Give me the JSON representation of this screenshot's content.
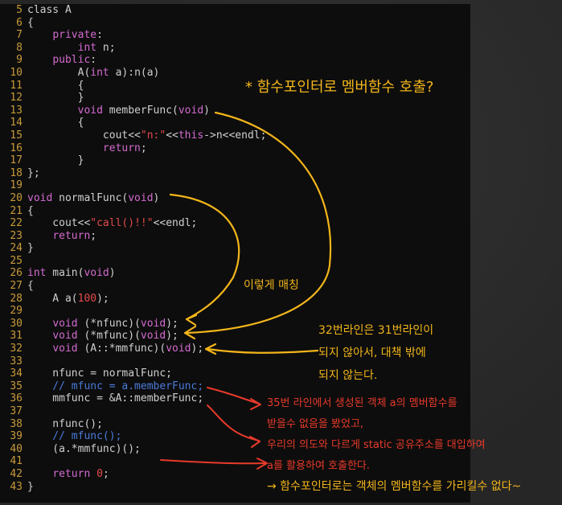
{
  "code_lines": [
    {
      "n": "5",
      "parts": [
        {
          "c": "txt",
          "t": "class A"
        }
      ]
    },
    {
      "n": "6",
      "parts": [
        {
          "c": "txt",
          "t": "{"
        }
      ]
    },
    {
      "n": "7",
      "parts": [
        {
          "c": "txt",
          "t": "    "
        },
        {
          "c": "kw",
          "t": "private"
        },
        {
          "c": "txt",
          "t": ":"
        }
      ]
    },
    {
      "n": "8",
      "parts": [
        {
          "c": "txt",
          "t": "        "
        },
        {
          "c": "kw",
          "t": "int"
        },
        {
          "c": "txt",
          "t": " n;"
        }
      ]
    },
    {
      "n": "9",
      "parts": [
        {
          "c": "txt",
          "t": "    "
        },
        {
          "c": "kw",
          "t": "public"
        },
        {
          "c": "txt",
          "t": ":"
        }
      ]
    },
    {
      "n": "10",
      "parts": [
        {
          "c": "txt",
          "t": "        A("
        },
        {
          "c": "kw",
          "t": "int"
        },
        {
          "c": "txt",
          "t": " a):n(a)"
        }
      ]
    },
    {
      "n": "11",
      "parts": [
        {
          "c": "txt",
          "t": "        {"
        }
      ]
    },
    {
      "n": "12",
      "parts": [
        {
          "c": "txt",
          "t": "        }"
        }
      ]
    },
    {
      "n": "13",
      "parts": [
        {
          "c": "txt",
          "t": "        "
        },
        {
          "c": "kw",
          "t": "void"
        },
        {
          "c": "txt",
          "t": " memberFunc("
        },
        {
          "c": "kw",
          "t": "void"
        },
        {
          "c": "txt",
          "t": ")"
        }
      ]
    },
    {
      "n": "14",
      "parts": [
        {
          "c": "txt",
          "t": "        {"
        }
      ]
    },
    {
      "n": "15",
      "parts": [
        {
          "c": "txt",
          "t": "            cout<<"
        },
        {
          "c": "str",
          "t": "\"n:\""
        },
        {
          "c": "txt",
          "t": "<<"
        },
        {
          "c": "kw",
          "t": "this"
        },
        {
          "c": "txt",
          "t": "->n<<endl;"
        }
      ]
    },
    {
      "n": "16",
      "parts": [
        {
          "c": "txt",
          "t": "            "
        },
        {
          "c": "kw",
          "t": "return"
        },
        {
          "c": "txt",
          "t": ";"
        }
      ]
    },
    {
      "n": "17",
      "parts": [
        {
          "c": "txt",
          "t": "        }"
        }
      ]
    },
    {
      "n": "18",
      "parts": [
        {
          "c": "txt",
          "t": "};"
        }
      ]
    },
    {
      "n": "19",
      "parts": [
        {
          "c": "txt",
          "t": ""
        }
      ]
    },
    {
      "n": "20",
      "parts": [
        {
          "c": "kw",
          "t": "void"
        },
        {
          "c": "txt",
          "t": " normalFunc("
        },
        {
          "c": "kw",
          "t": "void"
        },
        {
          "c": "txt",
          "t": ")"
        }
      ]
    },
    {
      "n": "21",
      "parts": [
        {
          "c": "txt",
          "t": "{"
        }
      ]
    },
    {
      "n": "22",
      "parts": [
        {
          "c": "txt",
          "t": "    cout<<"
        },
        {
          "c": "str",
          "t": "\"call()!!\""
        },
        {
          "c": "txt",
          "t": "<<endl;"
        }
      ]
    },
    {
      "n": "23",
      "parts": [
        {
          "c": "txt",
          "t": "    "
        },
        {
          "c": "kw",
          "t": "return"
        },
        {
          "c": "txt",
          "t": ";"
        }
      ]
    },
    {
      "n": "24",
      "parts": [
        {
          "c": "txt",
          "t": "}"
        }
      ]
    },
    {
      "n": "25",
      "parts": [
        {
          "c": "txt",
          "t": ""
        }
      ]
    },
    {
      "n": "26",
      "parts": [
        {
          "c": "kw",
          "t": "int"
        },
        {
          "c": "txt",
          "t": " main("
        },
        {
          "c": "kw",
          "t": "void"
        },
        {
          "c": "txt",
          "t": ")"
        }
      ]
    },
    {
      "n": "27",
      "parts": [
        {
          "c": "txt",
          "t": "{"
        }
      ]
    },
    {
      "n": "28",
      "parts": [
        {
          "c": "txt",
          "t": "    A a("
        },
        {
          "c": "num",
          "t": "100"
        },
        {
          "c": "txt",
          "t": ");"
        }
      ]
    },
    {
      "n": "29",
      "parts": [
        {
          "c": "txt",
          "t": ""
        }
      ]
    },
    {
      "n": "30",
      "parts": [
        {
          "c": "txt",
          "t": "    "
        },
        {
          "c": "kw",
          "t": "void"
        },
        {
          "c": "txt",
          "t": " (*nfunc)("
        },
        {
          "c": "kw",
          "t": "void"
        },
        {
          "c": "txt",
          "t": ");"
        }
      ]
    },
    {
      "n": "31",
      "parts": [
        {
          "c": "txt",
          "t": "    "
        },
        {
          "c": "kw",
          "t": "void"
        },
        {
          "c": "txt",
          "t": " (*mfunc)("
        },
        {
          "c": "kw",
          "t": "void"
        },
        {
          "c": "txt",
          "t": ");"
        }
      ]
    },
    {
      "n": "32",
      "parts": [
        {
          "c": "txt",
          "t": "    "
        },
        {
          "c": "kw",
          "t": "void"
        },
        {
          "c": "txt",
          "t": " (A::*mmfunc)("
        },
        {
          "c": "kw",
          "t": "void"
        },
        {
          "c": "txt",
          "t": ");"
        }
      ]
    },
    {
      "n": "33",
      "parts": [
        {
          "c": "txt",
          "t": ""
        }
      ]
    },
    {
      "n": "34",
      "parts": [
        {
          "c": "txt",
          "t": "    nfunc = normalFunc;"
        }
      ]
    },
    {
      "n": "35",
      "parts": [
        {
          "c": "cm",
          "t": "    // mfunc = a.memberFunc;"
        }
      ]
    },
    {
      "n": "36",
      "parts": [
        {
          "c": "txt",
          "t": "    mmfunc = &A::memberFunc;"
        }
      ]
    },
    {
      "n": "37",
      "parts": [
        {
          "c": "txt",
          "t": ""
        }
      ]
    },
    {
      "n": "38",
      "parts": [
        {
          "c": "txt",
          "t": "    nfunc();"
        }
      ]
    },
    {
      "n": "39",
      "parts": [
        {
          "c": "cm",
          "t": "    // mfunc();"
        }
      ]
    },
    {
      "n": "40",
      "parts": [
        {
          "c": "txt",
          "t": "    (a.*mmfunc)();"
        }
      ]
    },
    {
      "n": "41",
      "parts": [
        {
          "c": "txt",
          "t": ""
        }
      ]
    },
    {
      "n": "42",
      "parts": [
        {
          "c": "txt",
          "t": "    "
        },
        {
          "c": "kw",
          "t": "return"
        },
        {
          "c": "txt",
          "t": " "
        },
        {
          "c": "num",
          "t": "0"
        },
        {
          "c": "txt",
          "t": ";"
        }
      ]
    },
    {
      "n": "43",
      "parts": [
        {
          "c": "txt",
          "t": "}"
        }
      ]
    }
  ],
  "notes": {
    "title": "* 함수포인터로  멤버함수 호출?",
    "mapping": "이렇게 매칭",
    "line32_1": "32번라인은 31번라인이",
    "line32_2": "되지 않아서, 대책 밖에",
    "line32_3": "되지 않는다.",
    "red1": "35번 라인에서 생성된 객체 a의  멤버함수를",
    "red2": "받을수 없음을 봤었고,",
    "red3": "우리의 의도와 다르게 static 공유주소를 대입하여",
    "red4": "a를 활용하여 호출한다.",
    "conclusion": "→ 함수포인터로는 객체의 멤버함수를 가리킬수 없다~"
  },
  "colors": {
    "background": "#2b2b2b",
    "editor": "#0d0d0d",
    "line_number": "#c89a3a",
    "keyword": "#d36bd0",
    "string": "#e34a4a",
    "comment": "#4a7bd8",
    "annotation_yellow": "#f2b51a",
    "annotation_red": "#e83a2a"
  }
}
